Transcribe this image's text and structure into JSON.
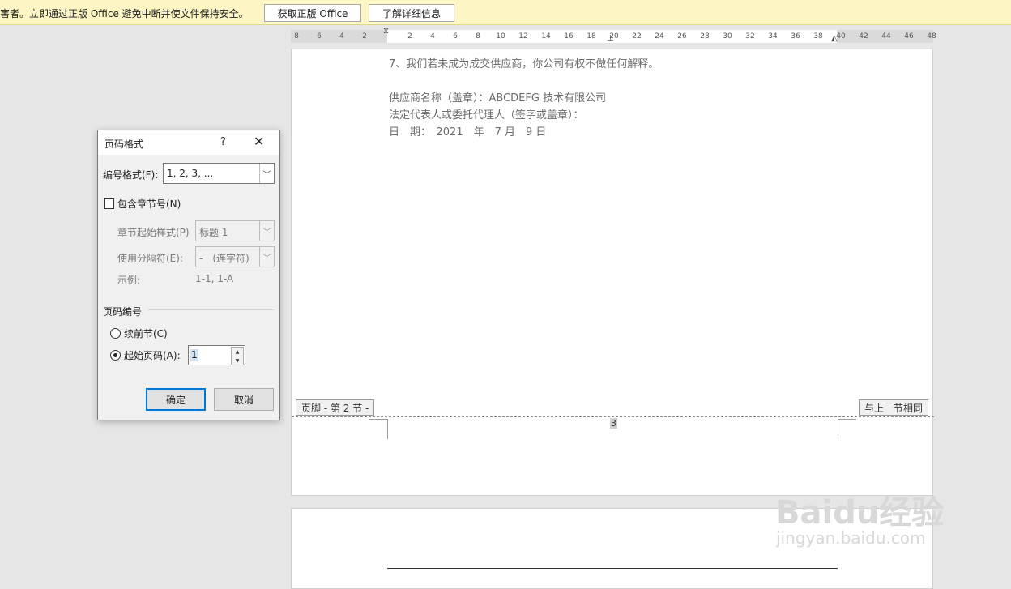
{
  "message_bar": {
    "text": "害者。立即通过正版 Office 避免中断并使文件保持安全。",
    "get_genuine_label": "获取正版 Office",
    "learn_more_label": "了解详细信息"
  },
  "ruler": {
    "ticks": [
      "8",
      "6",
      "4",
      "2",
      "2",
      "4",
      "6",
      "8",
      "10",
      "12",
      "14",
      "16",
      "18",
      "20",
      "22",
      "24",
      "26",
      "28",
      "30",
      "32",
      "34",
      "36",
      "38",
      "40",
      "42",
      "44",
      "46",
      "48"
    ]
  },
  "document": {
    "lines": [
      "7、我们若未成为成交供应商，你公司有权不做任何解释。",
      "供应商名称（盖章）：ABCDEFG 技术有限公司",
      "法定代表人或委托代理人（签字或盖章）：",
      "日　期：　2021　年　7 月　9 日"
    ],
    "footer_tag": "页脚 - 第 2 节 -",
    "same_as_previous_tag": "与上一节相同",
    "page_number": "3"
  },
  "dialog": {
    "title": "页码格式",
    "help": "?",
    "close": "✕",
    "number_format_label": "编号格式(F):",
    "number_format_value": "1, 2, 3, ...",
    "include_chapter_label": "包含章节号(N)",
    "chapter_style_label": "章节起始样式(P)",
    "chapter_style_value": "标题 1",
    "separator_label": "使用分隔符(E):",
    "separator_value": "-　(连字符)",
    "example_label": "示例:",
    "example_value": "1-1, 1-A",
    "page_numbering_label": "页码编号",
    "continue_label": "续前节(C)",
    "start_at_label": "起始页码(A):",
    "start_at_value": "1",
    "ok_label": "确定",
    "cancel_label": "取消"
  },
  "watermark": {
    "brand": "Baidu经验",
    "url": "jingyan.baidu.com"
  },
  "icons": {
    "dropdown": "chevron-down-icon",
    "spin_up": "spin-up-icon",
    "spin_down": "spin-down-icon"
  }
}
